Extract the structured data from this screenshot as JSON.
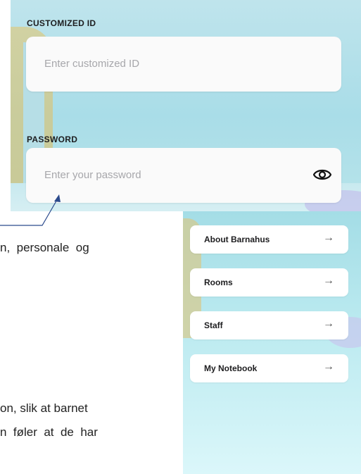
{
  "login": {
    "customized_id_label": "CUSTOMIZED ID",
    "customized_id_placeholder": "Enter customized ID",
    "password_label": "PASSWORD",
    "password_placeholder": "Enter your password",
    "toggle_icon": "eye-icon"
  },
  "body_text": {
    "line1": "n,  personale  og",
    "line2": "on, slik at barnet",
    "line3": "n  føler  at  de  har"
  },
  "menu": {
    "items": [
      {
        "label": "About Barnahus",
        "arrow": "→"
      },
      {
        "label": "Rooms",
        "arrow": "→"
      },
      {
        "label": "Staff",
        "arrow": "→"
      },
      {
        "label": "My Notebook",
        "arrow": "→"
      }
    ]
  },
  "colors": {
    "pointer_line": "#2b4a8c",
    "sky": "#a9dde8"
  }
}
